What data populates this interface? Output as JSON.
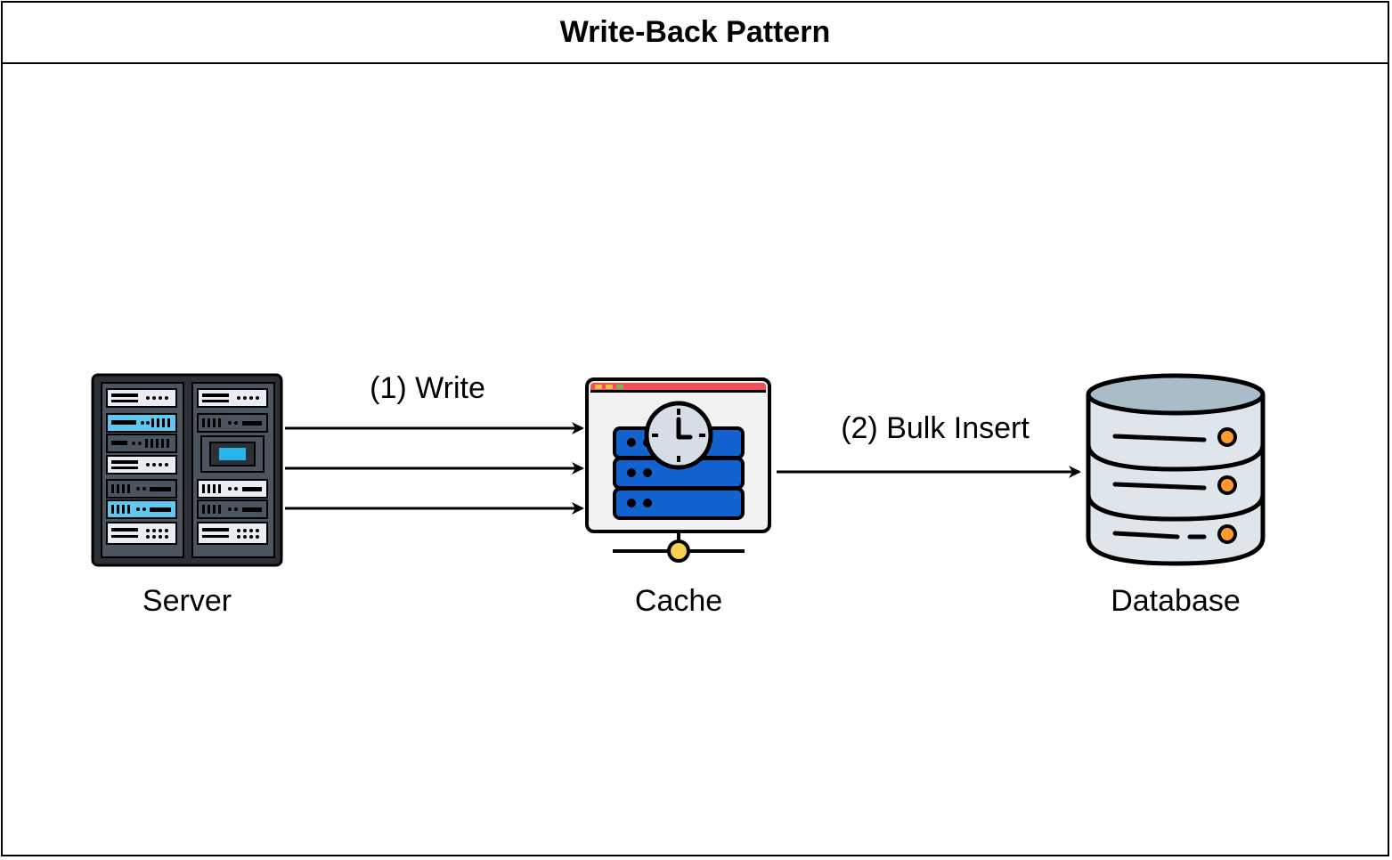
{
  "title": "Write-Back Pattern",
  "nodes": {
    "server": {
      "label": "Server",
      "icon": "server-rack-icon"
    },
    "cache": {
      "label": "Cache",
      "icon": "cache-server-clock-icon"
    },
    "database": {
      "label": "Database",
      "icon": "database-cylinder-icon"
    }
  },
  "edges": {
    "write": {
      "label": "(1) Write",
      "from": "server",
      "to": "cache",
      "count": 3
    },
    "bulk_insert": {
      "label": "(2) Bulk Insert",
      "from": "cache",
      "to": "database",
      "count": 1
    }
  },
  "colors": {
    "stroke": "#000000",
    "rack_dark": "#2b3137",
    "rack_light": "#e9edf1",
    "rack_accent": "#5ec8ee",
    "cache_blue": "#1262cf",
    "cache_top": "#f0505c",
    "db_body": "#dfe6eb",
    "db_top": "#a9bcc7",
    "db_light": "#ff9a2e"
  }
}
